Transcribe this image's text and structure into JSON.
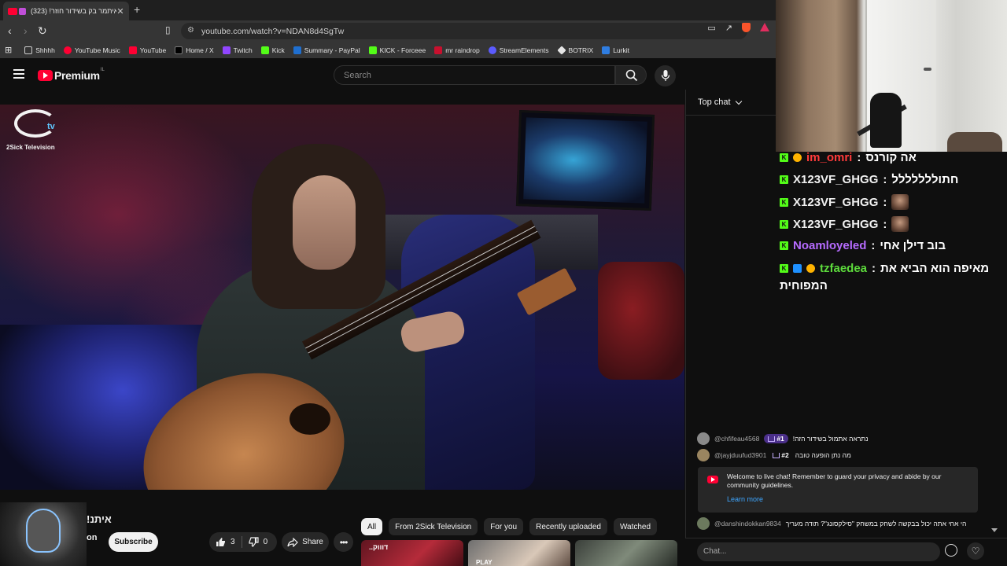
{
  "browser": {
    "tab_title": "איתמר בק בשידור חוזר! (323)",
    "url": "youtube.com/watch?v=NDAN8d4SgTw",
    "bookmarks": [
      {
        "label": "Shhhh",
        "color": "#3a3a3a"
      },
      {
        "label": "YouTube Music",
        "color": "#ff0033"
      },
      {
        "label": "YouTube",
        "color": "#ff0033"
      },
      {
        "label": "Home / X",
        "color": "#000000"
      },
      {
        "label": "Twitch",
        "color": "#9146ff"
      },
      {
        "label": "Kick",
        "color": "#53fc18"
      },
      {
        "label": "Summary - PayPal",
        "color": "#1f6fd0"
      },
      {
        "label": "KICK - Forceee",
        "color": "#53fc18"
      },
      {
        "label": "mr raindrop",
        "color": "#c8102e"
      },
      {
        "label": "StreamElements",
        "color": "#5b5bff"
      },
      {
        "label": "BOTRIX",
        "color": "#e5e5e5"
      },
      {
        "label": "Lurkit",
        "color": "#2f7de1"
      }
    ]
  },
  "youtube": {
    "brand": "Premium",
    "region": "IL",
    "search_placeholder": "Search"
  },
  "video": {
    "channel_overlay_name": "2Sick Television",
    "channel_overlay_tv": "tv",
    "title_fragment": "איתנ!",
    "channel_fragment": "on",
    "subscribe_label": "Subscribe",
    "like_count": "3",
    "dislike_count": "0",
    "share_label": "Share"
  },
  "chips": [
    "All",
    "From 2Sick Television",
    "For you",
    "Recently uploaded",
    "Watched"
  ],
  "recommended": [
    {
      "text": "..דוווק"
    },
    {
      "text": "PLAY"
    },
    {
      "text": ""
    }
  ],
  "chat": {
    "header_label": "Top chat",
    "kick_messages": [
      {
        "user": "im_omri",
        "user_color": "#ff3b3b",
        "text": "אה קורנס",
        "emote": false,
        "badges": [
          "#ffb300"
        ]
      },
      {
        "user": "X123VF_GHGG",
        "user_color": "#ffffff",
        "text": "חתוללללללל",
        "emote": false,
        "badges": []
      },
      {
        "user": "X123VF_GHGG",
        "user_color": "#ffffff",
        "text": "",
        "emote": true,
        "badges": []
      },
      {
        "user": "X123VF_GHGG",
        "user_color": "#ffffff",
        "text": "",
        "emote": true,
        "badges": []
      },
      {
        "user": "Noamloyeled",
        "user_color": "#b66bff",
        "text": "בוב דילן אחי",
        "emote": false,
        "badges": []
      },
      {
        "user": "tzfaedea",
        "user_color": "#5ddc3c",
        "text": "מאיפה הוא הביא את",
        "emote": false,
        "badges": [
          "#1e90ff",
          "#ffb300"
        ]
      }
    ],
    "kick_wrap_line": "המפוחית",
    "yt_messages": [
      {
        "author": "@chfifeau4568",
        "rank": "#1",
        "text": "נתראה אתמול בשידור הזה!"
      },
      {
        "author": "@jayjduufud3901",
        "rank": "#2",
        "text": "מה נתן הופעה טובה"
      }
    ],
    "welcome_text": "Welcome to live chat! Remember to guard your privacy and abide by our community guidelines.",
    "learn_more": "Learn more",
    "last_message": {
      "author": "@danshindokkan9834",
      "text": "הי אחי אתה יכול בבקשה לשחק במשחק \"סילקסונג\"? תודה מעריך"
    },
    "input_placeholder": "Chat..."
  }
}
